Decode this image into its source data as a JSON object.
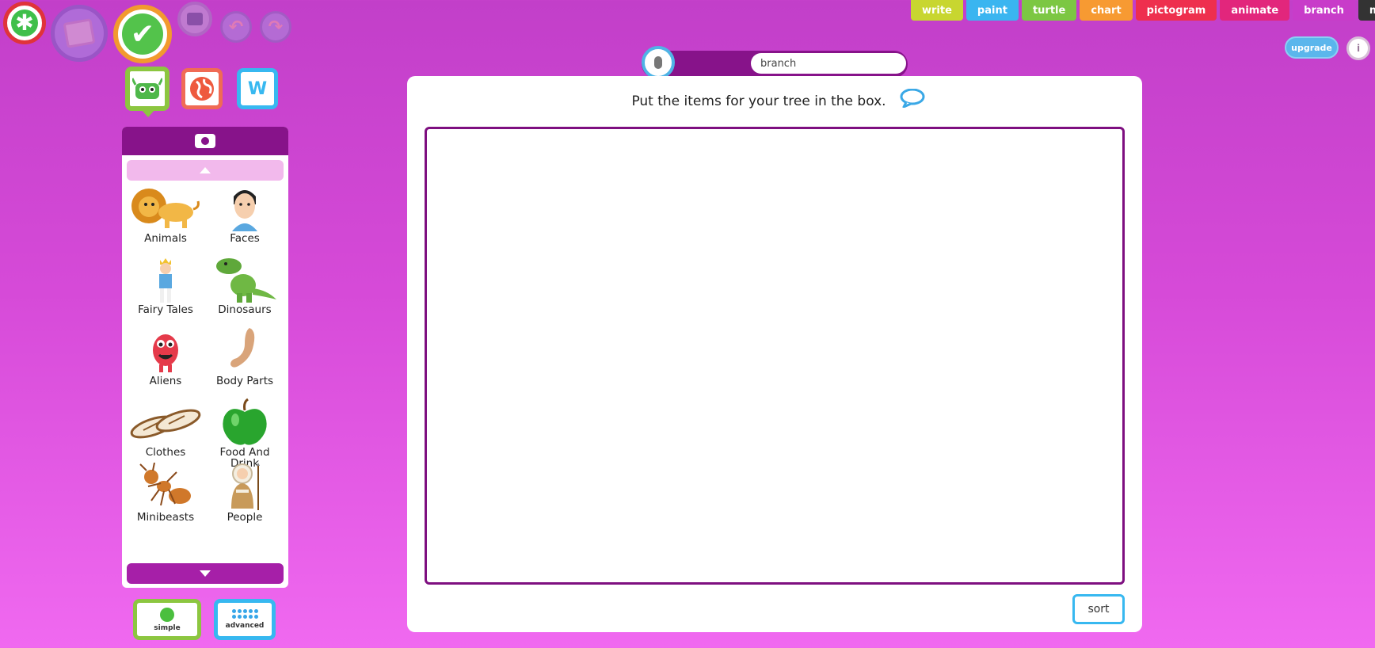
{
  "toolbar": {
    "new_glyph": "✱",
    "save_glyph": "✔",
    "undo_glyph": "↶",
    "redo_glyph": "↷"
  },
  "sources": {
    "word_glyph": "W"
  },
  "categories": [
    {
      "label": "Animals"
    },
    {
      "label": "Faces"
    },
    {
      "label": "Fairy Tales"
    },
    {
      "label": "Dinosaurs"
    },
    {
      "label": "Aliens"
    },
    {
      "label": "Body Parts"
    },
    {
      "label": "Clothes"
    },
    {
      "label": "Food And Drink"
    },
    {
      "label": "Minibeasts"
    },
    {
      "label": "People"
    }
  ],
  "modes": {
    "simple": "simple",
    "advanced": "advanced"
  },
  "apps": [
    {
      "label": "write",
      "color": "#c8d630"
    },
    {
      "label": "paint",
      "color": "#3ab5f0"
    },
    {
      "label": "turtle",
      "color": "#7cc743"
    },
    {
      "label": "chart",
      "color": "#f79a32"
    },
    {
      "label": "pictogram",
      "color": "#ee2f4e"
    },
    {
      "label": "animate",
      "color": "#e2267c"
    },
    {
      "label": "branch",
      "color": "#c83cc9"
    },
    {
      "label": "mix",
      "color": "#333333"
    }
  ],
  "header": {
    "upgrade": "upgrade",
    "info": "i",
    "file_name": "branch"
  },
  "main": {
    "instruction": "Put the items for your tree in the box.",
    "sort_label": "sort"
  }
}
